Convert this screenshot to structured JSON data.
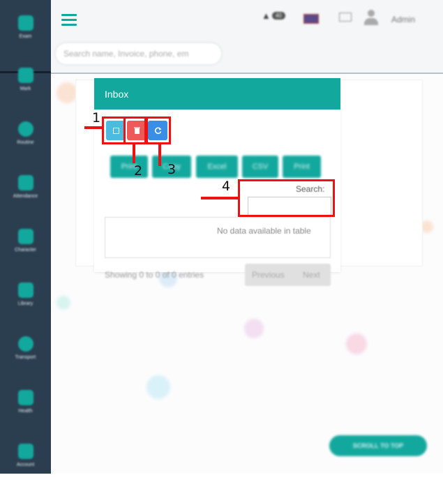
{
  "sidebar": {
    "items": [
      {
        "label": "Exam",
        "icon": "hourglass-icon"
      },
      {
        "label": "Mark",
        "icon": "flask-icon"
      },
      {
        "label": "Routine",
        "icon": "clock-icon"
      },
      {
        "label": "Attendance",
        "icon": "clipboard-icon"
      },
      {
        "label": "Character",
        "icon": "edit-icon"
      },
      {
        "label": "Library",
        "icon": "book-icon"
      },
      {
        "label": "Transport",
        "icon": "bus-icon"
      },
      {
        "label": "Health",
        "icon": "pill-icon"
      },
      {
        "label": "Account",
        "icon": "money-icon"
      }
    ]
  },
  "header": {
    "search_placeholder": "Search name, Invoice, phone, em",
    "notification_count": "40",
    "user_name": "Admin"
  },
  "panel": {
    "title": "Inbox",
    "export_buttons": [
      "Print",
      "Copy",
      "Excel",
      "CSV",
      "Print"
    ],
    "search_label": "Search:",
    "empty_message": "No data available in table",
    "showing": "Showing 0 to 0 of 0 entries",
    "prev": "Previous",
    "next": "Next"
  },
  "annotations": [
    "1",
    "2",
    "3",
    "4"
  ],
  "scroll_top": "SCROLL TO TOP",
  "colors": {
    "sidebar": "#2b3e50",
    "accent": "#13a89e",
    "button_select": "#4bbbe0",
    "button_delete": "#ee5a5a",
    "button_refresh": "#3a8ee6",
    "annotation": "#ee1111"
  }
}
